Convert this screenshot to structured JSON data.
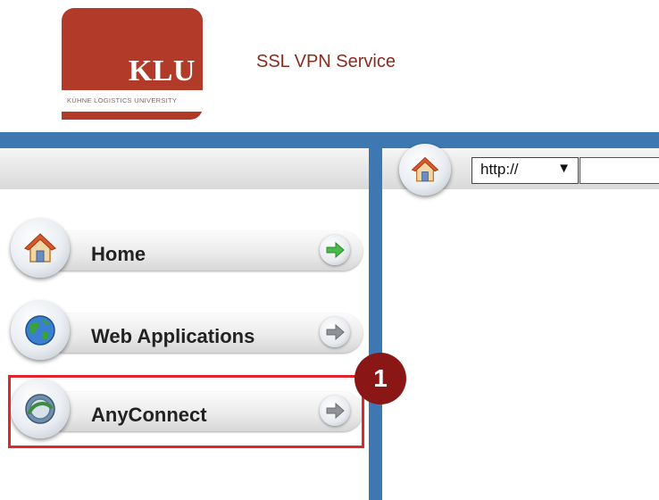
{
  "header": {
    "logo": {
      "wordmark": "KLU",
      "subtext": "KÜHNE LOGISTICS UNIVERSITY"
    },
    "service_title": "SSL VPN Service"
  },
  "colors": {
    "brand": "#b13a28",
    "frame_blue": "#3d78b2",
    "highlight": "#e0252c",
    "badge": "#8b1616"
  },
  "sidebar": {
    "items": [
      {
        "label": "Home",
        "icon": "home-icon",
        "arrow": "green-arrow-icon"
      },
      {
        "label": "Web Applications",
        "icon": "globe-icon",
        "arrow": "gray-arrow-icon"
      },
      {
        "label": "AnyConnect",
        "icon": "anyconnect-icon",
        "arrow": "gray-arrow-icon"
      }
    ]
  },
  "annotation": {
    "step": "1"
  },
  "addressbar": {
    "home_icon": "home-icon",
    "protocol": "http://",
    "url_value": ""
  }
}
